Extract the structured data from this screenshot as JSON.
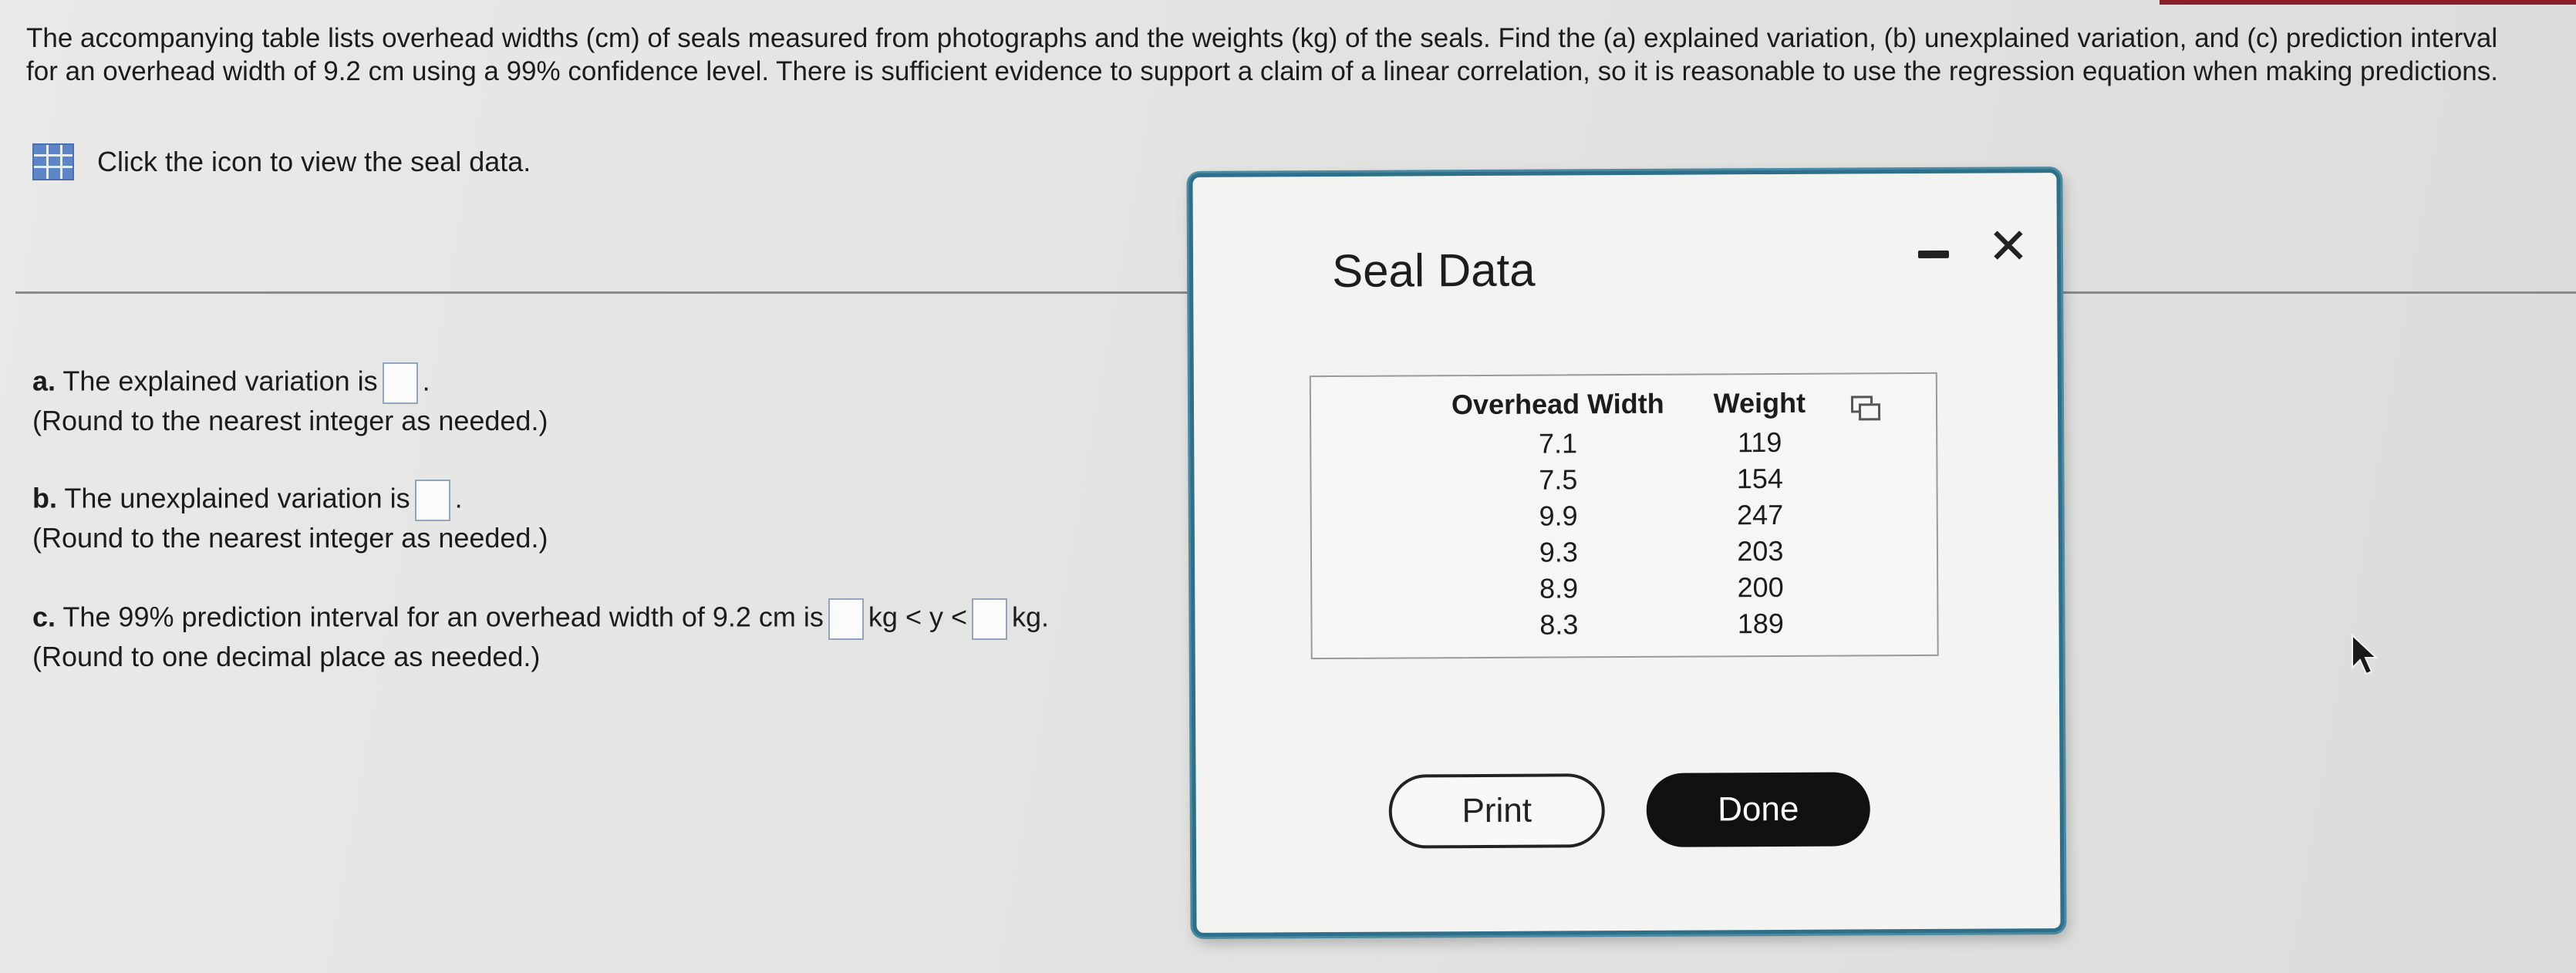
{
  "question": {
    "text": "The accompanying table lists overhead widths (cm) of seals measured from photographs and the weights (kg) of the seals. Find the (a) explained variation, (b) unexplained variation, and (c) prediction interval for an overhead width of 9.2 cm using a 99% confidence level. There is sufficient evidence to support a claim of a linear correlation, so it is reasonable to use the regression equation when making predictions.",
    "data_link": "Click the icon to view the seal data."
  },
  "parts": {
    "a": {
      "label": "a.",
      "text": "The explained variation is",
      "end": ".",
      "hint": "(Round to the nearest integer as needed.)"
    },
    "b": {
      "label": "b.",
      "text": "The unexplained variation is",
      "end": ".",
      "hint": "(Round to the nearest integer as needed.)"
    },
    "c": {
      "label": "c.",
      "text": "The 99% prediction interval for an overhead width of 9.2 cm is",
      "mid": "kg < y <",
      "end": "kg.",
      "hint": "(Round to one decimal place as needed.)"
    }
  },
  "dialog": {
    "title": "Seal Data",
    "columns": [
      "Overhead Width",
      "Weight"
    ],
    "rows": [
      [
        "7.1",
        "119"
      ],
      [
        "7.5",
        "154"
      ],
      [
        "9.9",
        "247"
      ],
      [
        "9.3",
        "203"
      ],
      [
        "8.9",
        "200"
      ],
      [
        "8.3",
        "189"
      ]
    ],
    "print_label": "Print",
    "done_label": "Done",
    "close_glyph": "✕"
  },
  "colors": {
    "dialog_border": "#2e6f8a",
    "grid_icon": "#5d86c9",
    "answer_box_border": "#8fa5c0"
  }
}
